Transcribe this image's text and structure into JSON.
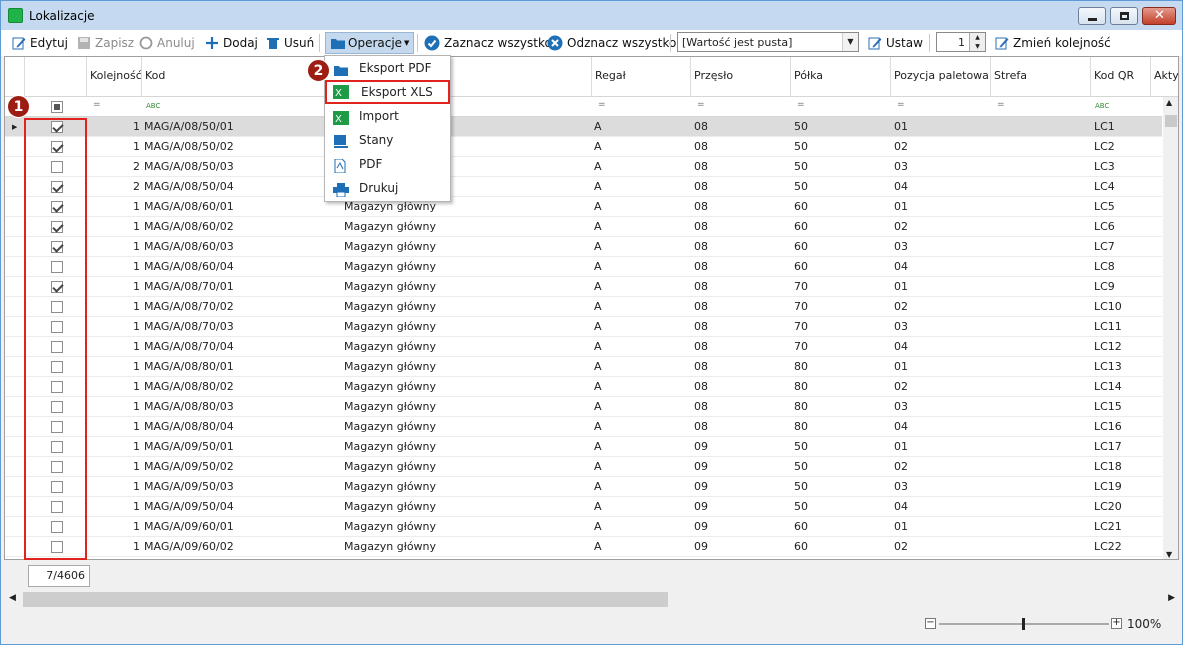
{
  "window": {
    "title": "Lokalizacje"
  },
  "toolbar": {
    "edit": "Edytuj",
    "save": "Zapisz",
    "cancel": "Anuluj",
    "add": "Dodaj",
    "delete": "Usuń",
    "operations": "Operacje",
    "select_all": "Zaznacz wszystko",
    "deselect_all": "Odznacz wszystko",
    "filter_value": "[Wartość jest pusta]",
    "set": "Ustaw",
    "order_value": "1",
    "change_order": "Zmień kolejność"
  },
  "menu": {
    "items": [
      "Eksport PDF",
      "Eksport XLS",
      "Import",
      "Stany",
      "PDF",
      "Drukuj"
    ]
  },
  "badges": {
    "one": "1",
    "two": "2"
  },
  "columns": [
    "Kolejność",
    "Kod",
    "Regał",
    "Przęsło",
    "Półka",
    "Pozycja paletowa",
    "Strefa",
    "Kod QR",
    "Akty"
  ],
  "filter_symbols": {
    "eq": "=",
    "text": "ABC"
  },
  "rows": [
    {
      "checked": true,
      "order": "1",
      "code": "MAG/A/08/50/01",
      "wh": "Magazyn główny",
      "rack": "A",
      "span": "08",
      "shelf": "50",
      "pos": "01",
      "qr": "LC1"
    },
    {
      "checked": true,
      "order": "1",
      "code": "MAG/A/08/50/02",
      "wh": "Magazyn główny",
      "rack": "A",
      "span": "08",
      "shelf": "50",
      "pos": "02",
      "qr": "LC2"
    },
    {
      "checked": false,
      "order": "2",
      "code": "MAG/A/08/50/03",
      "wh": "Magazyn główny",
      "rack": "A",
      "span": "08",
      "shelf": "50",
      "pos": "03",
      "qr": "LC3"
    },
    {
      "checked": true,
      "order": "2",
      "code": "MAG/A/08/50/04",
      "wh": "Magazyn główny",
      "rack": "A",
      "span": "08",
      "shelf": "50",
      "pos": "04",
      "qr": "LC4"
    },
    {
      "checked": true,
      "order": "1",
      "code": "MAG/A/08/60/01",
      "wh": "Magazyn główny",
      "rack": "A",
      "span": "08",
      "shelf": "60",
      "pos": "01",
      "qr": "LC5"
    },
    {
      "checked": true,
      "order": "1",
      "code": "MAG/A/08/60/02",
      "wh": "Magazyn główny",
      "rack": "A",
      "span": "08",
      "shelf": "60",
      "pos": "02",
      "qr": "LC6"
    },
    {
      "checked": true,
      "order": "1",
      "code": "MAG/A/08/60/03",
      "wh": "Magazyn główny",
      "rack": "A",
      "span": "08",
      "shelf": "60",
      "pos": "03",
      "qr": "LC7"
    },
    {
      "checked": false,
      "order": "1",
      "code": "MAG/A/08/60/04",
      "wh": "Magazyn główny",
      "rack": "A",
      "span": "08",
      "shelf": "60",
      "pos": "04",
      "qr": "LC8"
    },
    {
      "checked": true,
      "order": "1",
      "code": "MAG/A/08/70/01",
      "wh": "Magazyn główny",
      "rack": "A",
      "span": "08",
      "shelf": "70",
      "pos": "01",
      "qr": "LC9"
    },
    {
      "checked": false,
      "order": "1",
      "code": "MAG/A/08/70/02",
      "wh": "Magazyn główny",
      "rack": "A",
      "span": "08",
      "shelf": "70",
      "pos": "02",
      "qr": "LC10"
    },
    {
      "checked": false,
      "order": "1",
      "code": "MAG/A/08/70/03",
      "wh": "Magazyn główny",
      "rack": "A",
      "span": "08",
      "shelf": "70",
      "pos": "03",
      "qr": "LC11"
    },
    {
      "checked": false,
      "order": "1",
      "code": "MAG/A/08/70/04",
      "wh": "Magazyn główny",
      "rack": "A",
      "span": "08",
      "shelf": "70",
      "pos": "04",
      "qr": "LC12"
    },
    {
      "checked": false,
      "order": "1",
      "code": "MAG/A/08/80/01",
      "wh": "Magazyn główny",
      "rack": "A",
      "span": "08",
      "shelf": "80",
      "pos": "01",
      "qr": "LC13"
    },
    {
      "checked": false,
      "order": "1",
      "code": "MAG/A/08/80/02",
      "wh": "Magazyn główny",
      "rack": "A",
      "span": "08",
      "shelf": "80",
      "pos": "02",
      "qr": "LC14"
    },
    {
      "checked": false,
      "order": "1",
      "code": "MAG/A/08/80/03",
      "wh": "Magazyn główny",
      "rack": "A",
      "span": "08",
      "shelf": "80",
      "pos": "03",
      "qr": "LC15"
    },
    {
      "checked": false,
      "order": "1",
      "code": "MAG/A/08/80/04",
      "wh": "Magazyn główny",
      "rack": "A",
      "span": "08",
      "shelf": "80",
      "pos": "04",
      "qr": "LC16"
    },
    {
      "checked": false,
      "order": "1",
      "code": "MAG/A/09/50/01",
      "wh": "Magazyn główny",
      "rack": "A",
      "span": "09",
      "shelf": "50",
      "pos": "01",
      "qr": "LC17"
    },
    {
      "checked": false,
      "order": "1",
      "code": "MAG/A/09/50/02",
      "wh": "Magazyn główny",
      "rack": "A",
      "span": "09",
      "shelf": "50",
      "pos": "02",
      "qr": "LC18"
    },
    {
      "checked": false,
      "order": "1",
      "code": "MAG/A/09/50/03",
      "wh": "Magazyn główny",
      "rack": "A",
      "span": "09",
      "shelf": "50",
      "pos": "03",
      "qr": "LC19"
    },
    {
      "checked": false,
      "order": "1",
      "code": "MAG/A/09/50/04",
      "wh": "Magazyn główny",
      "rack": "A",
      "span": "09",
      "shelf": "50",
      "pos": "04",
      "qr": "LC20"
    },
    {
      "checked": false,
      "order": "1",
      "code": "MAG/A/09/60/01",
      "wh": "Magazyn główny",
      "rack": "A",
      "span": "09",
      "shelf": "60",
      "pos": "01",
      "qr": "LC21"
    },
    {
      "checked": false,
      "order": "1",
      "code": "MAG/A/09/60/02",
      "wh": "Magazyn główny",
      "rack": "A",
      "span": "09",
      "shelf": "60",
      "pos": "02",
      "qr": "LC22"
    }
  ],
  "footer": {
    "counter": "7/4606"
  },
  "zoom": {
    "value": "100%",
    "minus": "−",
    "plus": "+"
  },
  "colors": {
    "highlight": "#e0231c",
    "badge": "#9d1d12",
    "accent": "#1e6fb5"
  }
}
